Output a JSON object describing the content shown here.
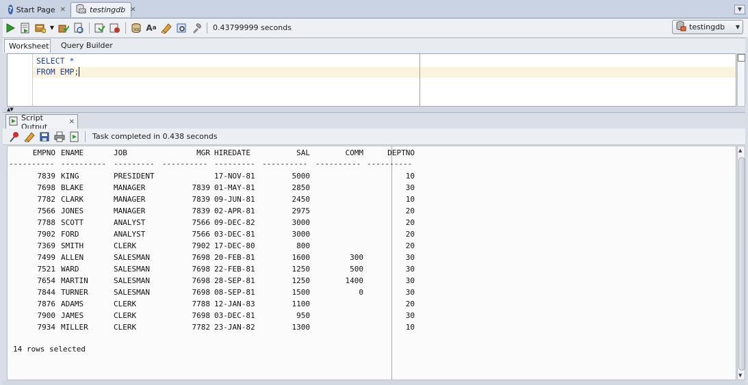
{
  "doc_tabs": [
    {
      "label": "Start Page"
    },
    {
      "label": "testingdb"
    }
  ],
  "toolbar": {
    "elapsed": "0.43799999 seconds",
    "connection": "testingdb"
  },
  "worksheet_tabs": [
    {
      "label": "Worksheet"
    },
    {
      "label": "Query Builder"
    }
  ],
  "editor": {
    "lines": [
      "SELECT *",
      "FROM EMP;"
    ]
  },
  "output_tab": {
    "label": "Script Output"
  },
  "output_status": "Task completed in 0.438 seconds",
  "results": {
    "columns": [
      "EMPNO",
      "ENAME",
      "JOB",
      "MGR",
      "HIREDATE",
      "SAL",
      "COMM",
      "DEPTNO"
    ],
    "separators": [
      "----------",
      "----------",
      "---------",
      "----------",
      "---------",
      "----------",
      "----------",
      "----------"
    ],
    "rows": [
      [
        "7839",
        "KING",
        "PRESIDENT",
        "",
        "17-NOV-81",
        "5000",
        "",
        "10"
      ],
      [
        "7698",
        "BLAKE",
        "MANAGER",
        "7839",
        "01-MAY-81",
        "2850",
        "",
        "30"
      ],
      [
        "7782",
        "CLARK",
        "MANAGER",
        "7839",
        "09-JUN-81",
        "2450",
        "",
        "10"
      ],
      [
        "7566",
        "JONES",
        "MANAGER",
        "7839",
        "02-APR-81",
        "2975",
        "",
        "20"
      ],
      [
        "7788",
        "SCOTT",
        "ANALYST",
        "7566",
        "09-DEC-82",
        "3000",
        "",
        "20"
      ],
      [
        "7902",
        "FORD",
        "ANALYST",
        "7566",
        "03-DEC-81",
        "3000",
        "",
        "20"
      ],
      [
        "7369",
        "SMITH",
        "CLERK",
        "7902",
        "17-DEC-80",
        "800",
        "",
        "20"
      ],
      [
        "7499",
        "ALLEN",
        "SALESMAN",
        "7698",
        "20-FEB-81",
        "1600",
        "300",
        "30"
      ],
      [
        "7521",
        "WARD",
        "SALESMAN",
        "7698",
        "22-FEB-81",
        "1250",
        "500",
        "30"
      ],
      [
        "7654",
        "MARTIN",
        "SALESMAN",
        "7698",
        "28-SEP-81",
        "1250",
        "1400",
        "30"
      ],
      [
        "7844",
        "TURNER",
        "SALESMAN",
        "7698",
        "08-SEP-81",
        "1500",
        "0",
        "30"
      ],
      [
        "7876",
        "ADAMS",
        "CLERK",
        "7788",
        "12-JAN-83",
        "1100",
        "",
        "20"
      ],
      [
        "7900",
        "JAMES",
        "CLERK",
        "7698",
        "03-DEC-81",
        "950",
        "",
        "30"
      ],
      [
        "7934",
        "MILLER",
        "CLERK",
        "7782",
        "23-JAN-82",
        "1300",
        "",
        "10"
      ]
    ],
    "footer": "14 rows selected"
  }
}
